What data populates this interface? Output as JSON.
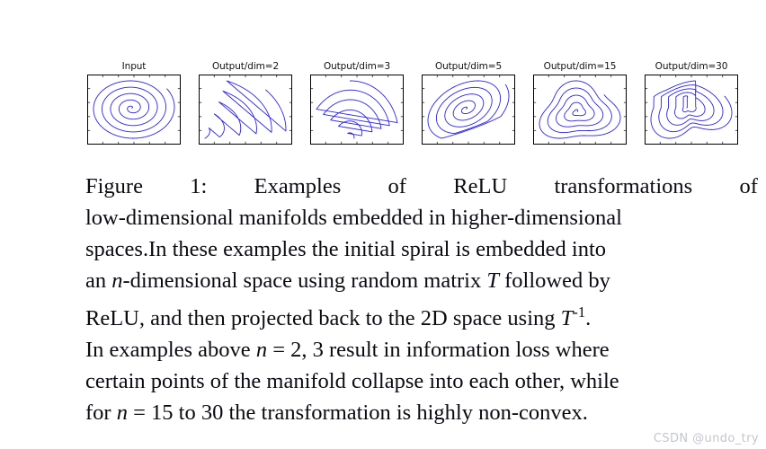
{
  "figure": {
    "panels": [
      {
        "title": "Input",
        "plot_name": "plot-input",
        "kind": "spiral",
        "turns": 5.1,
        "rotate": 0
      },
      {
        "title": "Output/dim=2",
        "plot_name": "plot-dim-2",
        "kind": "wedge",
        "turns": 5.1,
        "rotate": 0
      },
      {
        "title": "Output/dim=3",
        "plot_name": "plot-dim-3",
        "kind": "vfold",
        "turns": 5.1,
        "rotate": 0
      },
      {
        "title": "Output/dim=5",
        "plot_name": "plot-dim-5",
        "kind": "fold5",
        "turns": 5.1,
        "rotate": 0
      },
      {
        "title": "Output/dim=15",
        "plot_name": "plot-dim-15",
        "kind": "tri",
        "turns": 5.1,
        "rotate": 0
      },
      {
        "title": "Output/dim=30",
        "plot_name": "plot-dim-30",
        "kind": "pinch",
        "turns": 5.1,
        "rotate": 0
      }
    ],
    "curve_color": "#2a22dd",
    "axis_color": "#000000",
    "tick_color": "#555555",
    "background": "#ffffff"
  },
  "caption": {
    "label": "Figure 1:",
    "lines": [
      {
        "parts": [
          {
            "t": "Figure"
          },
          {
            "t": "1:"
          },
          {
            "t": "Examples"
          },
          {
            "t": "of"
          },
          {
            "t": "ReLU"
          },
          {
            "t": "transformations"
          },
          {
            "t": "of"
          }
        ],
        "justify": true
      },
      {
        "parts": [
          {
            "t": "low-dimensional manifolds embedded in higher-dimensional"
          }
        ],
        "justify": false
      },
      {
        "parts": [
          {
            "t": "spaces."
          },
          {
            "t": "In these examples the initial spiral is embedded into"
          }
        ],
        "justify": false
      },
      {
        "parts": [
          {
            "t": "an "
          },
          {
            "t": "n",
            "style": "mathit"
          },
          {
            "t": "-dimensional space using random matrix "
          },
          {
            "t": "T",
            "style": "mathit"
          },
          {
            "t": " followed by"
          }
        ],
        "justify": false
      },
      {
        "parts": [
          {
            "t": "ReLU, and then projected back to the 2D space using "
          },
          {
            "t": "T",
            "style": "mathit"
          },
          {
            "t": "-1",
            "style": "sup"
          },
          {
            "t": "."
          }
        ],
        "justify": false
      },
      {
        "parts": [
          {
            "t": "In examples above "
          },
          {
            "t": "n",
            "style": "mathit"
          },
          {
            "t": " = 2, 3 result in information loss where"
          }
        ],
        "justify": false
      },
      {
        "parts": [
          {
            "t": "certain points of the manifold collapse into each other, while"
          }
        ],
        "justify": false
      },
      {
        "parts": [
          {
            "t": "for "
          },
          {
            "t": "n",
            "style": "mathit"
          },
          {
            "t": " = 15 to 30 the transformation is highly non-convex."
          }
        ],
        "justify": false
      }
    ],
    "full_text": "Figure 1: Examples of ReLU transformations of low-dimensional manifolds embedded in higher-dimensional spaces. In these examples the initial spiral is embedded into an n-dimensional space using random matrix T followed by ReLU, and then projected back to the 2D space using T^-1. In examples above n = 2, 3 result in information loss where certain points of the manifold collapse into each other, while for n = 15 to 30 the transformation is highly non-convex."
  },
  "watermark": {
    "text": "CSDN @undo_try",
    "color": "#c3c6cc"
  },
  "chart_data": {
    "type": "line",
    "title": "Examples of ReLU transformations of low-dimensional manifolds",
    "xlabel": "",
    "ylabel": "",
    "grid": false,
    "legend": "none",
    "panels": [
      {
        "name": "Input",
        "description": "Original 2D Archimedean spiral, approximately 5 turns, undistorted",
        "dim": null,
        "turns": 5.1,
        "collapsed": false
      },
      {
        "name": "Output/dim=2",
        "description": "Spiral after embedding into 2D with random matrix T, ReLU, and inverse projection. Arcs collapse onto two thick straight edges forming a wedge/fan: a horizontal bottom edge and an upper-right diagonal edge. Severe information loss.",
        "dim": 2,
        "turns": 5.1,
        "collapsed": true
      },
      {
        "name": "Output/dim=3",
        "description": "Nested arcs collapsing onto two thick straight edges meeting in a V at the bottom; remaining loops form a fan of stacked humps. Information loss.",
        "dim": 3,
        "turns": 5.1,
        "collapsed": true
      },
      {
        "name": "Output/dim=5",
        "description": "Spiral largely preserved but flattened along the lower-left and lower-right boundary where loops bunch together; shape is a skewed convex blob.",
        "dim": 5,
        "turns": 5.1,
        "collapsed": false
      },
      {
        "name": "Output/dim=15",
        "description": "Spiral fully preserved, distorted into a rounded-triangular, non-convex outline.",
        "dim": 15,
        "turns": 5.1,
        "collapsed": false
      },
      {
        "name": "Output/dim=30",
        "description": "Spiral fully preserved, strongly non-convex; loops bunch densely along the upper-left to centre region forming a dark wedge.",
        "dim": 30,
        "turns": 5.1,
        "collapsed": false
      }
    ]
  }
}
